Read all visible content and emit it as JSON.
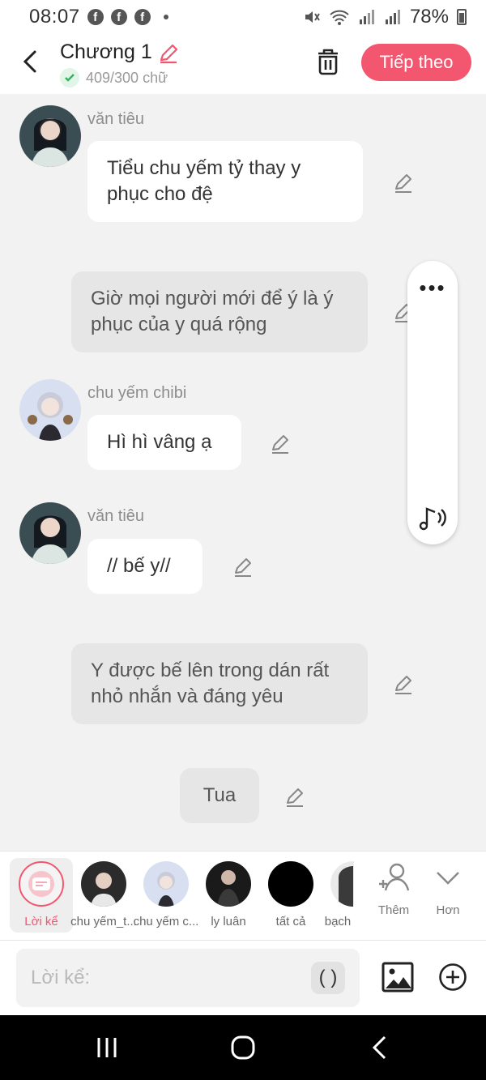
{
  "status": {
    "time": "08:07",
    "battery": "78%"
  },
  "header": {
    "title": "Chương 1",
    "word_count": "409/300 chữ",
    "next_label": "Tiếp theo"
  },
  "messages": [
    {
      "speaker": "văn tiêu",
      "text": "Tiểu chu yếm tỷ thay y phục cho đệ"
    },
    {
      "text": "Giờ mọi người mới để ý là ý phục của y quá rộng"
    },
    {
      "speaker": "chu yếm chibi",
      "text": "Hì hì vâng ạ"
    },
    {
      "speaker": "văn tiêu",
      "text": "// bế y//"
    },
    {
      "text": "Y được bế lên trong dán rất nhỏ nhắn và đáng yêu"
    },
    {
      "text": "Tua"
    }
  ],
  "characters": [
    {
      "label": "Lời kể",
      "selected": true
    },
    {
      "label": "chu yếm_t..."
    },
    {
      "label": "chu yếm c..."
    },
    {
      "label": "ly luân"
    },
    {
      "label": "tất cả"
    },
    {
      "label": "bạch"
    }
  ],
  "tools": {
    "add_label": "Thêm",
    "more_label": "Hơn"
  },
  "input": {
    "placeholder": "Lời kể:",
    "paren": "( )"
  },
  "colors": {
    "accent": "#f2576f",
    "background": "#f2f2f2",
    "narration_bubble": "#e6e6e6"
  }
}
